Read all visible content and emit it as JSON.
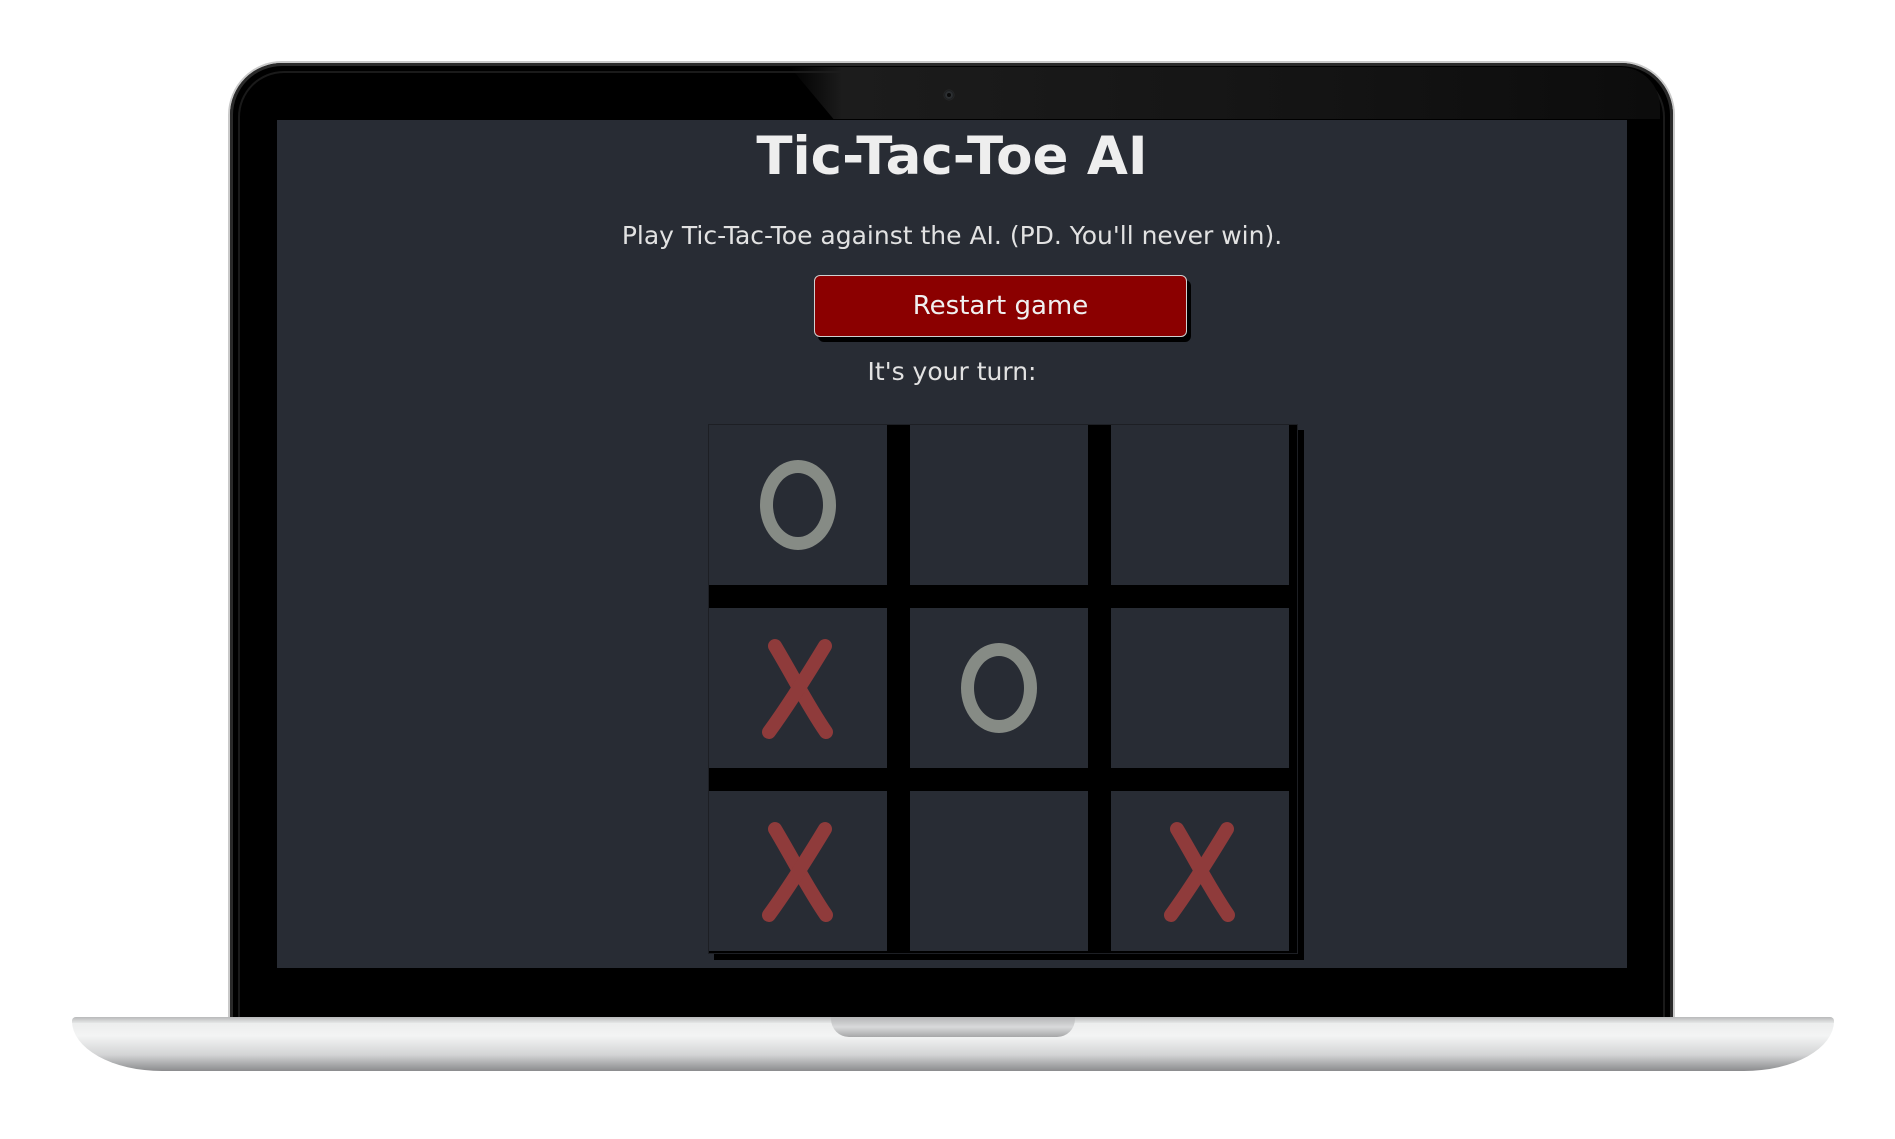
{
  "app": {
    "title": "Tic-Tac-Toe AI",
    "subtitle": "Play Tic-Tac-Toe against the AI. (PD. You'll never win).",
    "restart_label": "Restart game",
    "turn_status": "It's your turn:"
  },
  "board": {
    "cells": [
      {
        "mark": "O"
      },
      {
        "mark": ""
      },
      {
        "mark": ""
      },
      {
        "mark": "X"
      },
      {
        "mark": "O"
      },
      {
        "mark": ""
      },
      {
        "mark": "X"
      },
      {
        "mark": ""
      },
      {
        "mark": "X"
      }
    ]
  },
  "colors": {
    "screen_bg": "#282c34",
    "button_bg": "#8b0000",
    "x_mark": "#8f3b3b",
    "o_mark": "#868b85"
  }
}
